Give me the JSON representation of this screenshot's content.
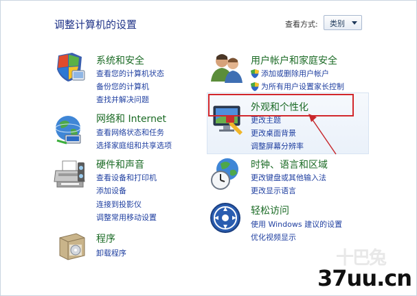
{
  "page": {
    "title": "调整计算机的设置",
    "view_label": "查看方式:",
    "view_value": "类别"
  },
  "categories": {
    "security": {
      "title": "系统和安全",
      "links": [
        "查看您的计算机状态",
        "备份您的计算机",
        "查找并解决问题"
      ]
    },
    "network": {
      "title": "网络和 Internet",
      "links": [
        "查看网络状态和任务",
        "选择家庭组和共享选项"
      ]
    },
    "hardware": {
      "title": "硬件和声音",
      "links": [
        "查看设备和打印机",
        "添加设备",
        "连接到投影仪",
        "调整常用移动设置"
      ]
    },
    "programs": {
      "title": "程序",
      "links": [
        "卸载程序"
      ]
    },
    "users": {
      "title": "用户帐户和家庭安全",
      "links": [
        "添加或删除用户帐户",
        "为所有用户设置家长控制"
      ]
    },
    "appearance": {
      "title": "外观和个性化",
      "links": [
        "更改主题",
        "更改桌面背景",
        "调整屏幕分辨率"
      ]
    },
    "clock": {
      "title": "时钟、语言和区域",
      "links": [
        "更改键盘或其他输入法",
        "更改显示语言"
      ]
    },
    "access": {
      "title": "轻松访问",
      "links": [
        "使用 Windows 建议的设置",
        "优化视频显示"
      ]
    }
  },
  "watermark": {
    "logo_text": "十巴兔",
    "site": "37uu.cn"
  },
  "colors": {
    "title_green": "#1a6a24",
    "link_blue": "#1f3fa0",
    "highlight_red": "#d2262a"
  }
}
